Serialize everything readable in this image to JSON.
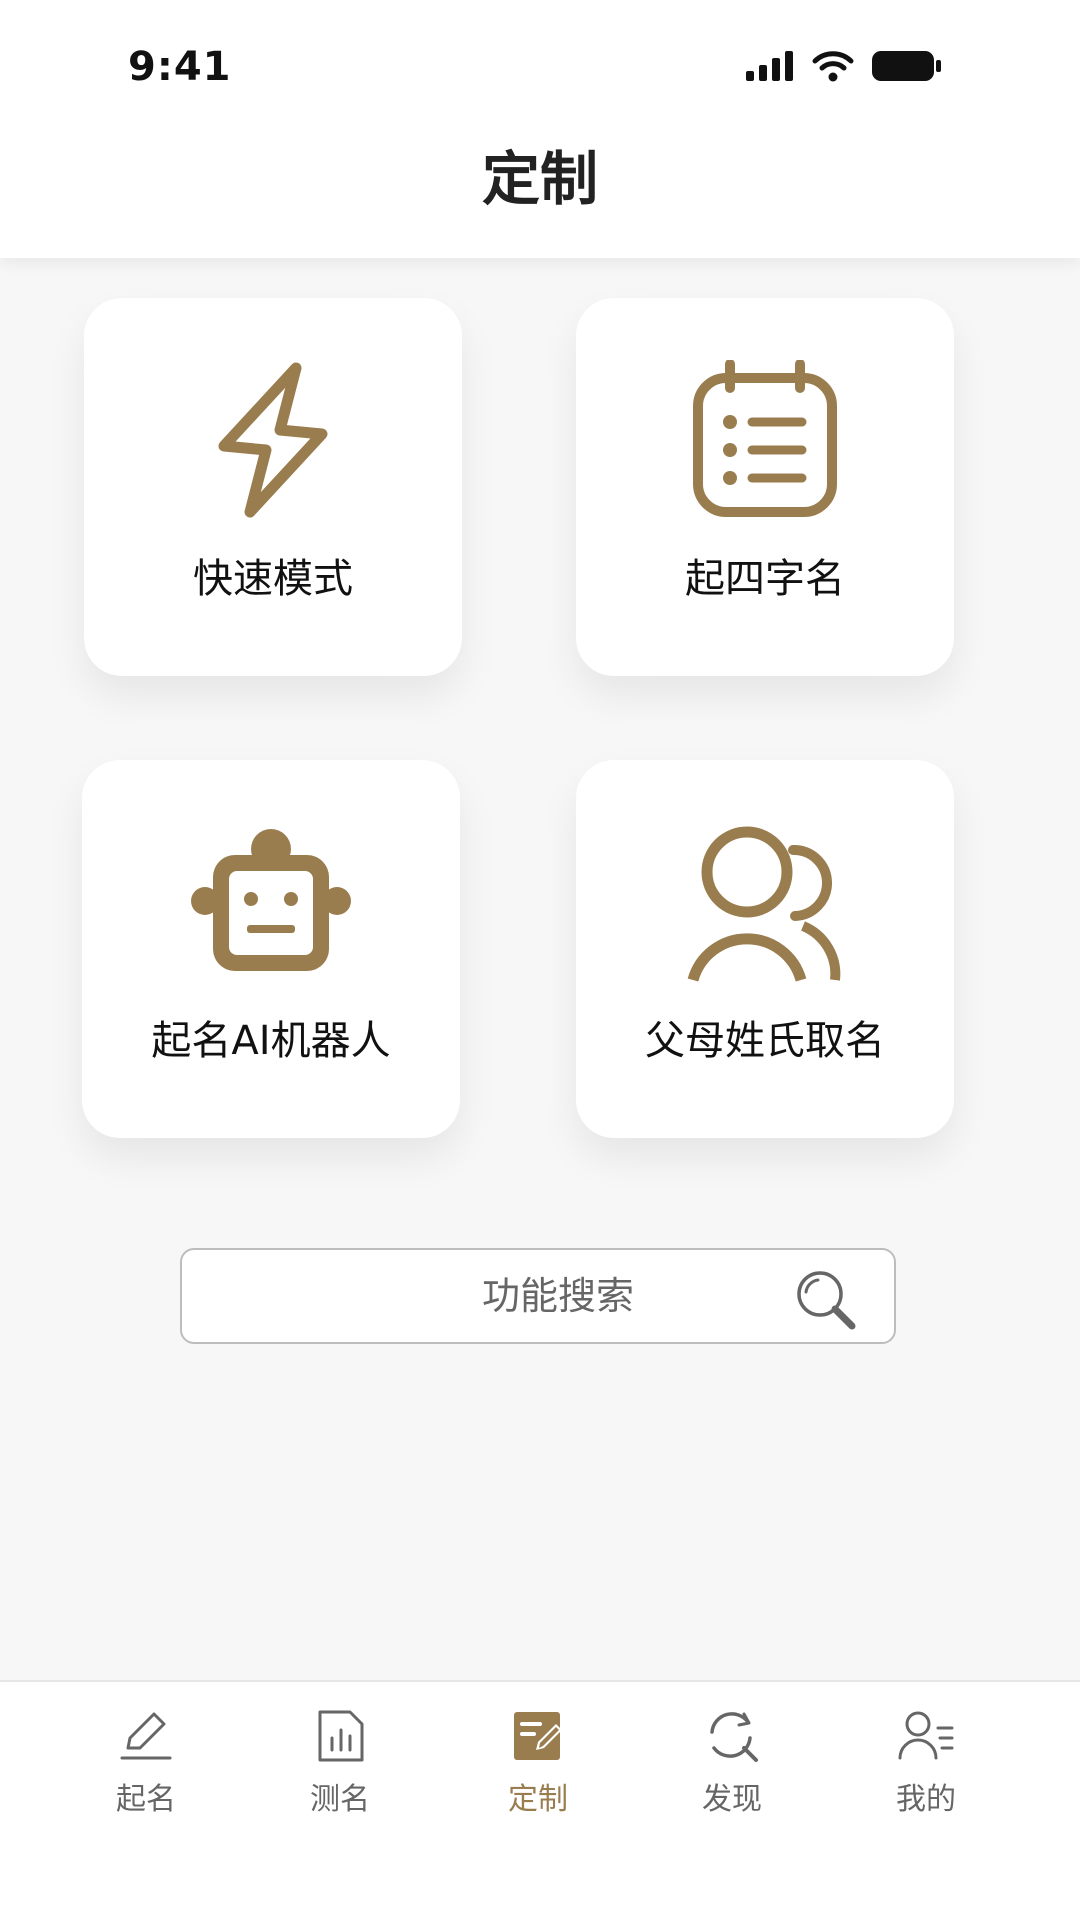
{
  "status_bar": {
    "time": "9:41",
    "icons": [
      "signal-icon",
      "wifi-icon",
      "battery-icon"
    ]
  },
  "header": {
    "title": "定制"
  },
  "colors": {
    "accent": "#9a7d4e",
    "text": "#111111",
    "muted": "#666666"
  },
  "cards": [
    {
      "label": "快速模式",
      "icon": "lightning-icon"
    },
    {
      "label": "起四字名",
      "icon": "notepad-icon"
    },
    {
      "label": "起名AI机器人",
      "icon": "robot-icon"
    },
    {
      "label": "父母姓氏取名",
      "icon": "family-icon"
    }
  ],
  "search": {
    "placeholder": "功能搜索",
    "value": "",
    "icon": "search-icon"
  },
  "tabbar": {
    "active_index": 2,
    "items": [
      {
        "label": "起名",
        "icon": "pen-icon"
      },
      {
        "label": "测名",
        "icon": "report-icon"
      },
      {
        "label": "定制",
        "icon": "edit-doc-icon"
      },
      {
        "label": "发现",
        "icon": "discover-icon"
      },
      {
        "label": "我的",
        "icon": "profile-icon"
      }
    ]
  }
}
